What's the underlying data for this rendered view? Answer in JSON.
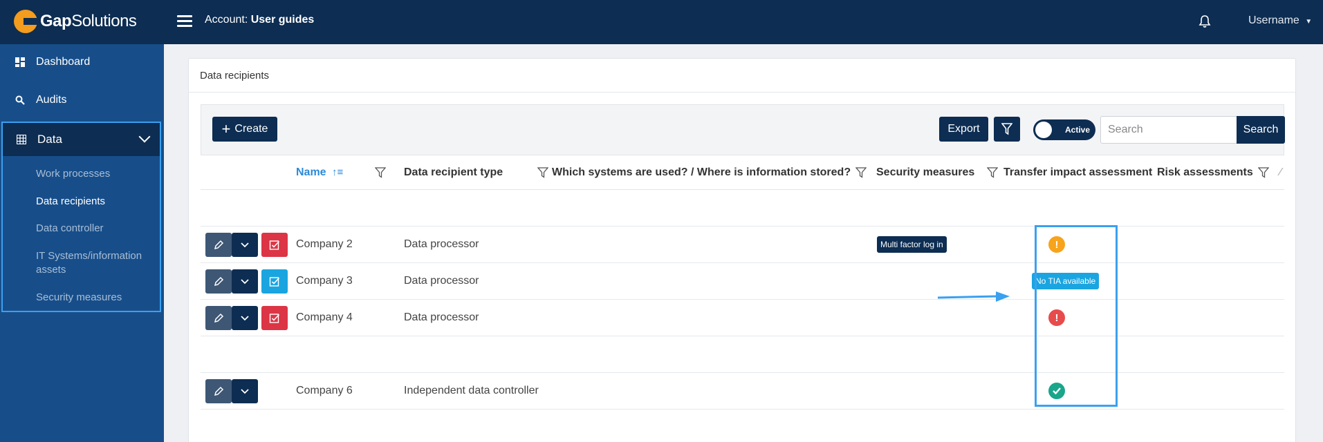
{
  "app": {
    "logo_bold": "Gap",
    "logo_light": "Solutions",
    "account_prefix": "Account:",
    "account_name": "User guides",
    "username": "Username"
  },
  "sidebar": {
    "items": [
      {
        "label": "Dashboard",
        "icon": "dashboard-icon"
      },
      {
        "label": "Audits",
        "icon": "search-icon"
      },
      {
        "label": "Data",
        "icon": "table-icon"
      }
    ],
    "data_subitems": [
      {
        "label": "Work processes"
      },
      {
        "label": "Data recipients",
        "active": true
      },
      {
        "label": "Data controller"
      },
      {
        "label": "IT Systems/information assets"
      },
      {
        "label": "Security measures"
      }
    ]
  },
  "page": {
    "title": "Data recipients"
  },
  "toolbar": {
    "create_label": "Create",
    "export_label": "Export",
    "toggle_label": "Active",
    "search_placeholder": "Search",
    "search_button_label": "Search"
  },
  "table": {
    "columns": [
      {
        "label": "Name",
        "sorted": "asc"
      },
      {
        "label": "Data recipient type"
      },
      {
        "label": "Which systems are used? / Where is information stored?"
      },
      {
        "label": "Security measures"
      },
      {
        "label": "Transfer impact assessment"
      },
      {
        "label": "Risk assessments"
      }
    ],
    "rows": [
      {
        "name": "Company 2",
        "type": "Data processor",
        "security": "Multi factor log in",
        "tia": "warning",
        "status_button": "red"
      },
      {
        "name": "Company 3",
        "type": "Data processor",
        "security": "",
        "tia": "No TIA available",
        "status_button": "blue"
      },
      {
        "name": "Company 4",
        "type": "Data processor",
        "security": "",
        "tia": "error",
        "status_button": "red"
      },
      {
        "name": "Company 6",
        "type": "Independent data controller",
        "security": "",
        "tia": "ok",
        "status_button": "none"
      }
    ]
  },
  "colors": {
    "navy": "#0d2d52",
    "sidebar": "#174e8a",
    "accent_blue": "#3aa0f0",
    "warning": "#f7a31c",
    "danger": "#e84b4b",
    "success": "#19a68a"
  }
}
